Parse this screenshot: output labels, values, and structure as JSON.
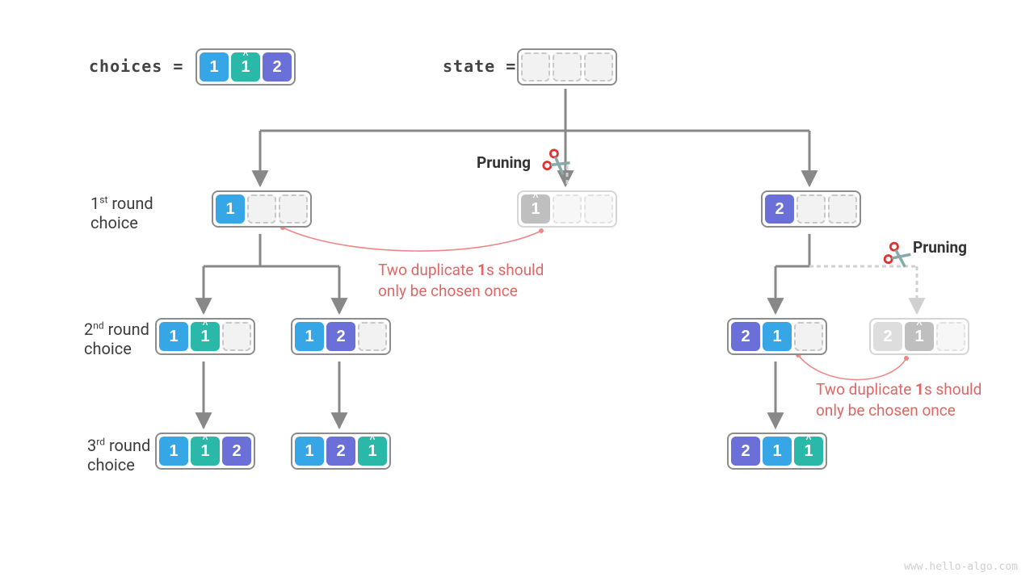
{
  "header": {
    "choices_label": "choices =",
    "state_label": "state ="
  },
  "row_labels": {
    "r1a": "1",
    "r1b": "st",
    "r1c": " round",
    "r1d": "choice",
    "r2a": "2",
    "r2b": "nd",
    "r2c": " round",
    "r2d": "choice",
    "r3a": "3",
    "r3b": "rd",
    "r3c": " round",
    "r3d": "choice"
  },
  "cells": {
    "one": "1",
    "one_hat": "1",
    "two": "2"
  },
  "pruning": {
    "label": "Pruning"
  },
  "notes": {
    "dup1": "Two duplicate ",
    "dup1b": "1",
    "dup1c": "s should",
    "dup1d": "only be chosen once"
  },
  "watermark": "www.hello-algo.com",
  "chart_data": {
    "type": "tree",
    "description": "Permutation tree with duplicate pruning",
    "choices": [
      "1",
      "1^",
      "2"
    ],
    "initial_state": [
      "_",
      "_",
      "_"
    ],
    "levels": [
      {
        "name": "1st round choice",
        "nodes": [
          {
            "id": "A",
            "state": [
              "1",
              "_",
              "_"
            ],
            "pruned": false
          },
          {
            "id": "B",
            "state": [
              "1^",
              "_",
              "_"
            ],
            "pruned": true,
            "reason": "duplicate of 1"
          },
          {
            "id": "C",
            "state": [
              "2",
              "_",
              "_"
            ],
            "pruned": false
          }
        ]
      },
      {
        "name": "2nd round choice",
        "nodes": [
          {
            "id": "A1",
            "parent": "A",
            "state": [
              "1",
              "1^",
              "_"
            ],
            "pruned": false
          },
          {
            "id": "A2",
            "parent": "A",
            "state": [
              "1",
              "2",
              "_"
            ],
            "pruned": false
          },
          {
            "id": "C1",
            "parent": "C",
            "state": [
              "2",
              "1",
              "_"
            ],
            "pruned": false
          },
          {
            "id": "C2",
            "parent": "C",
            "state": [
              "2",
              "1^",
              "_"
            ],
            "pruned": true,
            "reason": "duplicate of 1"
          }
        ]
      },
      {
        "name": "3rd round choice",
        "nodes": [
          {
            "id": "A1x",
            "parent": "A1",
            "state": [
              "1",
              "1^",
              "2"
            ],
            "pruned": false
          },
          {
            "id": "A2x",
            "parent": "A2",
            "state": [
              "1",
              "2",
              "1^"
            ],
            "pruned": false
          },
          {
            "id": "C1x",
            "parent": "C1",
            "state": [
              "2",
              "1",
              "1^"
            ],
            "pruned": false
          }
        ]
      }
    ],
    "annotations": [
      "Two duplicate 1s should only be chosen once",
      "Two duplicate 1s should only be chosen once"
    ]
  }
}
